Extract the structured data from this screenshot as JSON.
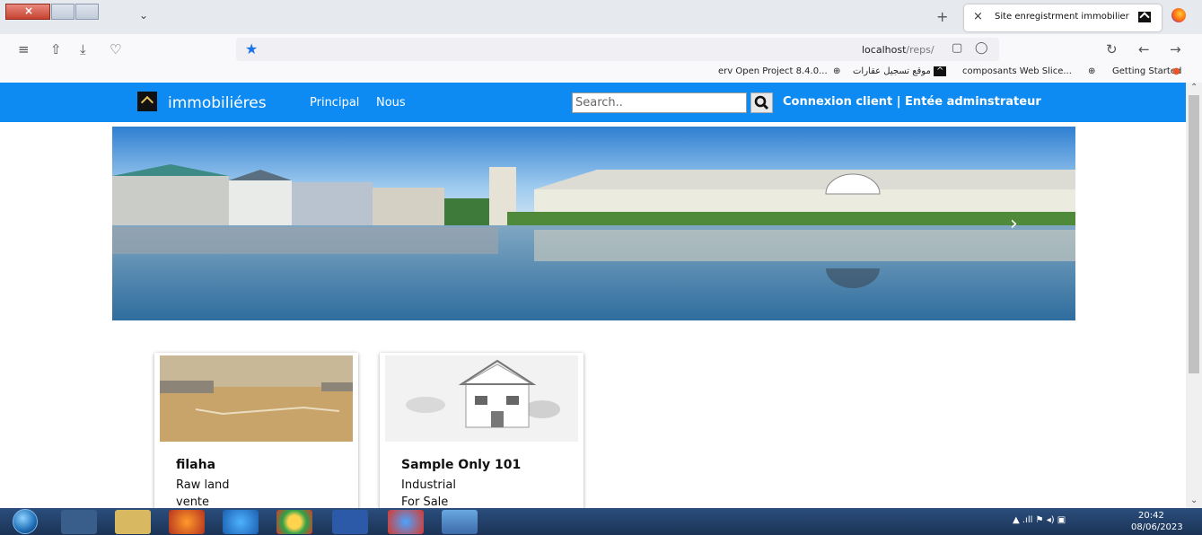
{
  "browser": {
    "active_tab_title": "Site enregistrment immobilier",
    "new_tab_glyph": "+",
    "tab_close_glyph": "×",
    "url_host": "localhost",
    "url_path": "/reps/",
    "bookmarks": [
      "Getting Started",
      "composants Web Slice...",
      "موقع تسجيل عقارات",
      "erv Open Project 8.4.0..."
    ]
  },
  "site": {
    "brand": "immobiliéres",
    "nav": [
      "Principal",
      "Nous"
    ],
    "search_placeholder": "Search..",
    "login_text": "Connexion client | Entée adminstrateur",
    "accent_color": "#0d8bf2"
  },
  "listings": [
    {
      "title": "filaha",
      "category": "Raw land",
      "status": "vente"
    },
    {
      "title": "Sample Only 101",
      "category": "Industrial",
      "status": "For Sale"
    }
  ],
  "taskbar": {
    "time": "20:42",
    "date": "08/06/2023"
  }
}
